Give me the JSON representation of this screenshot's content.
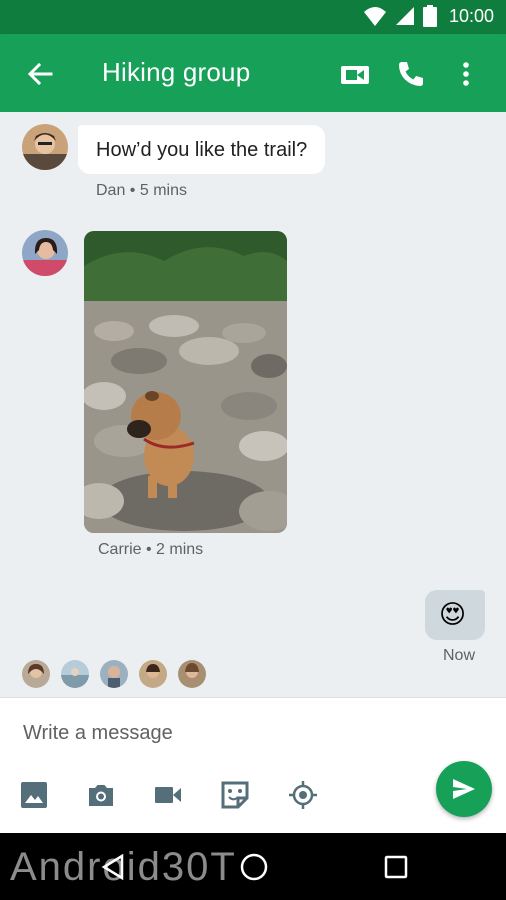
{
  "status_bar": {
    "time": "10:00"
  },
  "app_bar": {
    "title": "Hiking group"
  },
  "messages": [
    {
      "text": "How’d you like the trail?",
      "meta": "Dan • 5 mins"
    },
    {
      "meta": "Carrie • 2 mins"
    },
    {
      "emoji": "😍",
      "meta": "Now"
    }
  ],
  "composer": {
    "placeholder": "Write a message"
  },
  "watermark": "Android30T",
  "colors": {
    "status_bar": "#0f7d3d",
    "app_bar": "#16a058",
    "accent": "#16a058",
    "chat_bg": "#eceff1",
    "outgoing_bubble": "#cfd8dc"
  },
  "icons": [
    "wifi-icon",
    "signal-icon",
    "battery-icon",
    "back-arrow-icon",
    "video-call-icon",
    "phone-icon",
    "more-vert-icon",
    "image-icon",
    "camera-icon",
    "video-icon",
    "sticker-icon",
    "location-icon",
    "send-icon",
    "nav-back-icon",
    "nav-home-icon",
    "nav-recents-icon"
  ]
}
